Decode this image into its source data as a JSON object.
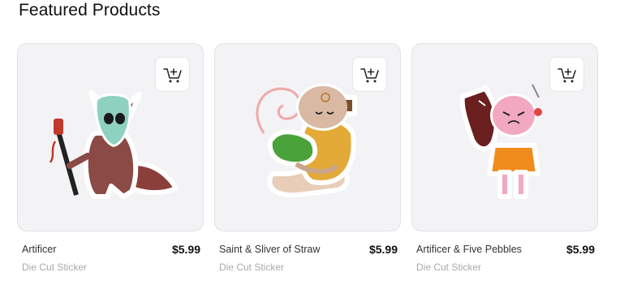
{
  "section": {
    "title": "Featured Products"
  },
  "products": [
    {
      "name": "Artificer",
      "price": "$5.99",
      "type": "Die Cut Sticker",
      "cart_icon": "add-to-cart-icon"
    },
    {
      "name": "Saint & Sliver of Straw",
      "price": "$5.99",
      "type": "Die Cut Sticker",
      "cart_icon": "add-to-cart-icon"
    },
    {
      "name": "Artificer & Five Pebbles",
      "price": "$5.99",
      "type": "Die Cut Sticker",
      "cart_icon": "add-to-cart-icon"
    }
  ],
  "colors": {
    "card_bg": "#f3f3f5",
    "card_border": "#e3e3e6",
    "subtext": "#a9a9ae"
  }
}
